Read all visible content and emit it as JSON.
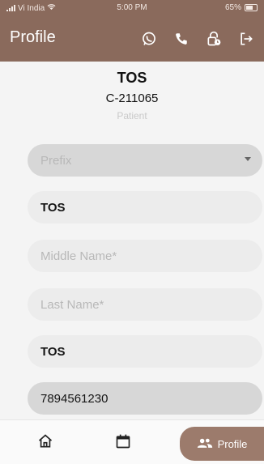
{
  "status_bar": {
    "carrier": "Vi India",
    "time": "5:00 PM",
    "battery": "65%"
  },
  "app_bar": {
    "title": "Profile"
  },
  "profile": {
    "name": "TOS",
    "code": "C-211065",
    "role": "Patient"
  },
  "form": {
    "prefix": {
      "placeholder": "Prefix",
      "value": ""
    },
    "first_name": {
      "value": "TOS"
    },
    "middle_name": {
      "placeholder": "Middle Name*",
      "value": ""
    },
    "last_name": {
      "placeholder": "Last Name*",
      "value": ""
    },
    "display_name": {
      "value": "TOS"
    },
    "phone": {
      "value": "7894561230"
    }
  },
  "bottom_nav": {
    "profile_label": "Profile"
  },
  "colors": {
    "primary": "#8a6a5c",
    "active_tab": "#9c7b6c"
  }
}
